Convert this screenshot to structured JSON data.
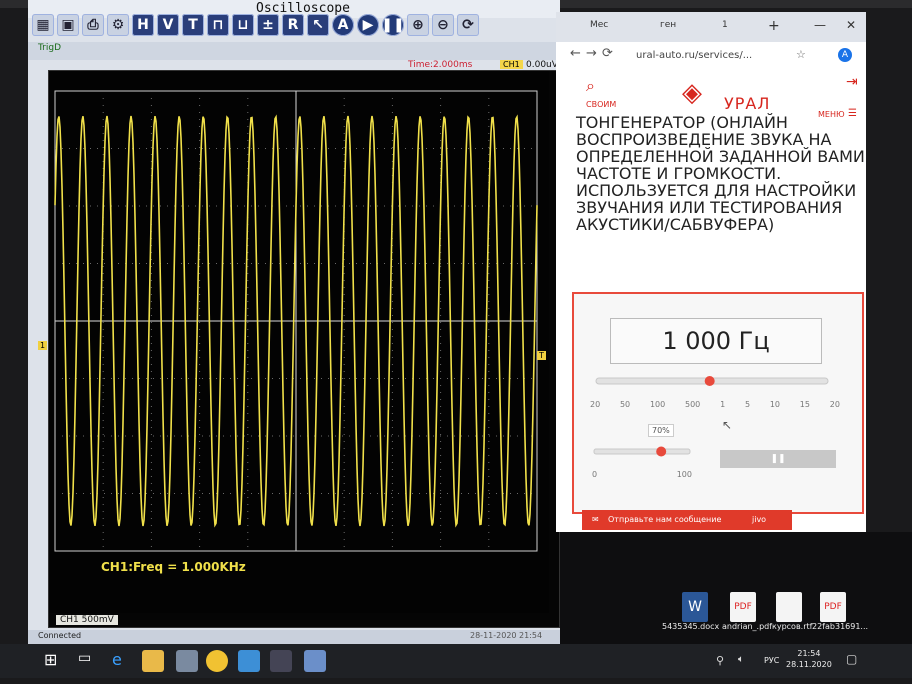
{
  "oscilloscope": {
    "title": "Oscilloscope",
    "toolbar": [
      "H",
      "V",
      "T",
      "R"
    ],
    "trigger": "TrigD",
    "time_base": "Time:2.000ms",
    "trigger_level": "0.00uV",
    "ch_badge": "CH1",
    "measurement": "CH1:Freq = 1.000KHz",
    "ch1_scale": "500mV",
    "status": "Connected",
    "status_date": "28-11-2020 21:54",
    "marker_left": "1",
    "marker_right": "T"
  },
  "browser": {
    "tabs": [
      "Мес",
      "ген",
      "1"
    ],
    "url": "ural-auto.ru/services/...",
    "logo": "УРАЛ",
    "left_label": "СВОИМ",
    "menu": "МЕНЮ",
    "content": "ТОНГЕНЕРАТОР (ОНЛАЙН ВОСПРОИЗВЕДЕНИЕ ЗВУКА НА ОПРЕДЕЛЕННОЙ ЗАДАННОЙ ВАМИ ЧАСТОТЕ И ГРОМКОСТИ. ИСПОЛЬЗУЕТСЯ ДЛЯ НАСТРОЙКИ ЗВУЧАНИЯ ИЛИ ТЕСТИРОВАНИЯ АКУСТИКИ/САБВУФЕРА)",
    "generator": {
      "frequency": "1 000 Гц",
      "freq_ticks": [
        "20",
        "50",
        "100",
        "500",
        "1",
        "5",
        "10",
        "15",
        "20"
      ],
      "volume": "70%",
      "volume_ticks": [
        "0",
        "100"
      ],
      "frequency_value": 1000,
      "volume_value": 0.7
    },
    "chat": "Отправьте нам сообщение",
    "chat_brand": "jivo"
  },
  "desktop": {
    "files": [
      "5435345.docx",
      "andrian_.pdf",
      "курсов.rtf",
      "22fab31691..."
    ]
  },
  "taskbar": {
    "lang": "РУС",
    "time": "21:54",
    "date": "28.11.2020"
  }
}
